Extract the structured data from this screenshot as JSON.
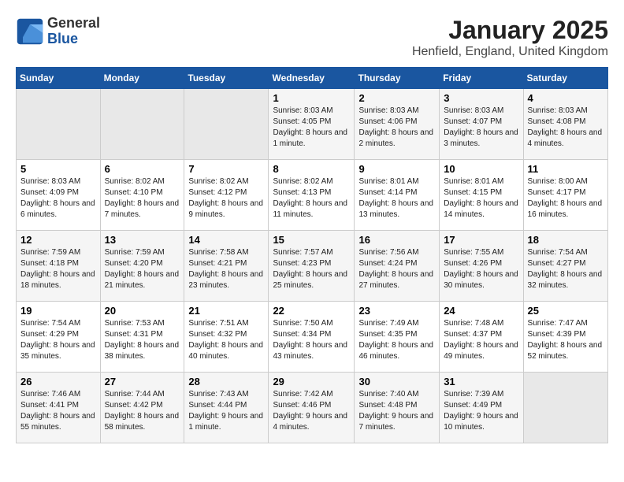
{
  "header": {
    "logo": {
      "general": "General",
      "blue": "Blue"
    },
    "title": "January 2025",
    "subtitle": "Henfield, England, United Kingdom"
  },
  "weekdays": [
    "Sunday",
    "Monday",
    "Tuesday",
    "Wednesday",
    "Thursday",
    "Friday",
    "Saturday"
  ],
  "weeks": [
    [
      {
        "day": null
      },
      {
        "day": null
      },
      {
        "day": null
      },
      {
        "day": "1",
        "sunrise": "8:03 AM",
        "sunset": "4:05 PM",
        "daylight": "8 hours and 1 minute."
      },
      {
        "day": "2",
        "sunrise": "8:03 AM",
        "sunset": "4:06 PM",
        "daylight": "8 hours and 2 minutes."
      },
      {
        "day": "3",
        "sunrise": "8:03 AM",
        "sunset": "4:07 PM",
        "daylight": "8 hours and 3 minutes."
      },
      {
        "day": "4",
        "sunrise": "8:03 AM",
        "sunset": "4:08 PM",
        "daylight": "8 hours and 4 minutes."
      }
    ],
    [
      {
        "day": "5",
        "sunrise": "8:03 AM",
        "sunset": "4:09 PM",
        "daylight": "8 hours and 6 minutes."
      },
      {
        "day": "6",
        "sunrise": "8:02 AM",
        "sunset": "4:10 PM",
        "daylight": "8 hours and 7 minutes."
      },
      {
        "day": "7",
        "sunrise": "8:02 AM",
        "sunset": "4:12 PM",
        "daylight": "8 hours and 9 minutes."
      },
      {
        "day": "8",
        "sunrise": "8:02 AM",
        "sunset": "4:13 PM",
        "daylight": "8 hours and 11 minutes."
      },
      {
        "day": "9",
        "sunrise": "8:01 AM",
        "sunset": "4:14 PM",
        "daylight": "8 hours and 13 minutes."
      },
      {
        "day": "10",
        "sunrise": "8:01 AM",
        "sunset": "4:15 PM",
        "daylight": "8 hours and 14 minutes."
      },
      {
        "day": "11",
        "sunrise": "8:00 AM",
        "sunset": "4:17 PM",
        "daylight": "8 hours and 16 minutes."
      }
    ],
    [
      {
        "day": "12",
        "sunrise": "7:59 AM",
        "sunset": "4:18 PM",
        "daylight": "8 hours and 18 minutes."
      },
      {
        "day": "13",
        "sunrise": "7:59 AM",
        "sunset": "4:20 PM",
        "daylight": "8 hours and 21 minutes."
      },
      {
        "day": "14",
        "sunrise": "7:58 AM",
        "sunset": "4:21 PM",
        "daylight": "8 hours and 23 minutes."
      },
      {
        "day": "15",
        "sunrise": "7:57 AM",
        "sunset": "4:23 PM",
        "daylight": "8 hours and 25 minutes."
      },
      {
        "day": "16",
        "sunrise": "7:56 AM",
        "sunset": "4:24 PM",
        "daylight": "8 hours and 27 minutes."
      },
      {
        "day": "17",
        "sunrise": "7:55 AM",
        "sunset": "4:26 PM",
        "daylight": "8 hours and 30 minutes."
      },
      {
        "day": "18",
        "sunrise": "7:54 AM",
        "sunset": "4:27 PM",
        "daylight": "8 hours and 32 minutes."
      }
    ],
    [
      {
        "day": "19",
        "sunrise": "7:54 AM",
        "sunset": "4:29 PM",
        "daylight": "8 hours and 35 minutes."
      },
      {
        "day": "20",
        "sunrise": "7:53 AM",
        "sunset": "4:31 PM",
        "daylight": "8 hours and 38 minutes."
      },
      {
        "day": "21",
        "sunrise": "7:51 AM",
        "sunset": "4:32 PM",
        "daylight": "8 hours and 40 minutes."
      },
      {
        "day": "22",
        "sunrise": "7:50 AM",
        "sunset": "4:34 PM",
        "daylight": "8 hours and 43 minutes."
      },
      {
        "day": "23",
        "sunrise": "7:49 AM",
        "sunset": "4:35 PM",
        "daylight": "8 hours and 46 minutes."
      },
      {
        "day": "24",
        "sunrise": "7:48 AM",
        "sunset": "4:37 PM",
        "daylight": "8 hours and 49 minutes."
      },
      {
        "day": "25",
        "sunrise": "7:47 AM",
        "sunset": "4:39 PM",
        "daylight": "8 hours and 52 minutes."
      }
    ],
    [
      {
        "day": "26",
        "sunrise": "7:46 AM",
        "sunset": "4:41 PM",
        "daylight": "8 hours and 55 minutes."
      },
      {
        "day": "27",
        "sunrise": "7:44 AM",
        "sunset": "4:42 PM",
        "daylight": "8 hours and 58 minutes."
      },
      {
        "day": "28",
        "sunrise": "7:43 AM",
        "sunset": "4:44 PM",
        "daylight": "9 hours and 1 minute."
      },
      {
        "day": "29",
        "sunrise": "7:42 AM",
        "sunset": "4:46 PM",
        "daylight": "9 hours and 4 minutes."
      },
      {
        "day": "30",
        "sunrise": "7:40 AM",
        "sunset": "4:48 PM",
        "daylight": "9 hours and 7 minutes."
      },
      {
        "day": "31",
        "sunrise": "7:39 AM",
        "sunset": "4:49 PM",
        "daylight": "9 hours and 10 minutes."
      },
      {
        "day": null
      }
    ]
  ]
}
